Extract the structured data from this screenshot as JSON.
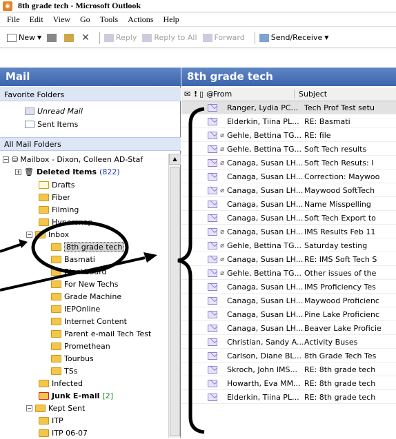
{
  "window": {
    "title": "8th grade tech - Microsoft Outlook"
  },
  "menu": [
    "File",
    "Edit",
    "View",
    "Go",
    "Tools",
    "Actions",
    "Help"
  ],
  "toolbar": {
    "new": "New",
    "reply": "Reply",
    "reply_all": "Reply to All",
    "forward": "Forward",
    "send_receive": "Send/Receive"
  },
  "left": {
    "header": "Mail",
    "favorites_title": "Favorite Folders",
    "favorites": [
      "Unread Mail",
      "Sent Items"
    ],
    "all_title": "All Mail Folders",
    "mailbox": "Mailbox - Dixon, Colleen   AD-Staf",
    "deleted": {
      "label": "Deleted Items",
      "count": "(822)"
    },
    "folders_top": [
      "Drafts",
      "Fiber",
      "Filming",
      "Hypersnap"
    ],
    "inbox": "Inbox",
    "inbox_children": [
      "8th grade tech",
      "Basmati",
      "Blackboard",
      "For New Techs",
      "Grade Machine",
      "IEPOnline",
      "Internet Content",
      "Parent e-mail Tech Test",
      "Promethean",
      "Tourbus",
      "TSs"
    ],
    "infected": "Infected",
    "junk": {
      "label": "Junk E-mail",
      "count": "[2]"
    },
    "kept": "Kept Sent",
    "kept_children": [
      "ITP",
      "ITP 06-07"
    ]
  },
  "right": {
    "header": "8th grade tech",
    "col_from": "From",
    "col_subject": "Subject",
    "messages": [
      {
        "attach": false,
        "from": "Ranger, Lydia   PC...",
        "subject": "Tech Prof Test setu"
      },
      {
        "attach": false,
        "from": "Elderkin, Tiina   PL...",
        "subject": "RE: Basmati"
      },
      {
        "attach": true,
        "from": "Gehle, Bettina   TG...",
        "subject": "RE: file"
      },
      {
        "attach": true,
        "from": "Gehle, Bettina   TG...",
        "subject": "Soft Tech results"
      },
      {
        "attach": true,
        "from": "Canaga, Susan   LH...",
        "subject": "Soft Tech Resuts: I"
      },
      {
        "attach": false,
        "from": "Canaga, Susan   LH...",
        "subject": "Correction: Maywoo"
      },
      {
        "attach": true,
        "from": "Canaga, Susan   LH...",
        "subject": "Maywood SoftTech"
      },
      {
        "attach": false,
        "from": "Canaga, Susan   LH...",
        "subject": "Name Misspelling"
      },
      {
        "attach": false,
        "from": "Canaga, Susan   LH...",
        "subject": "Soft Tech Export to"
      },
      {
        "attach": true,
        "from": "Canaga, Susan   LH...",
        "subject": "IMS Results Feb 11"
      },
      {
        "attach": true,
        "from": "Gehle, Bettina   TG...",
        "subject": "Saturday testing"
      },
      {
        "attach": true,
        "from": "Canaga, Susan   LH...",
        "subject": "RE: IMS Soft Tech S"
      },
      {
        "attach": true,
        "from": "Gehle, Bettina   TG...",
        "subject": "Other issues of the"
      },
      {
        "attach": false,
        "from": "Canaga, Susan   LH...",
        "subject": "IMS Proficiency Tes"
      },
      {
        "attach": false,
        "from": "Canaga, Susan   LH...",
        "subject": "Maywood Proficienc"
      },
      {
        "attach": false,
        "from": "Canaga, Susan   LH...",
        "subject": "Pine Lake Proficienc"
      },
      {
        "attach": false,
        "from": "Canaga, Susan   LH...",
        "subject": "Beaver Lake Proficie"
      },
      {
        "attach": false,
        "from": "Christian, Sandy   A...",
        "subject": "Activity Buses"
      },
      {
        "attach": false,
        "from": "Carlson, Diane   BL...",
        "subject": "8th Grade Tech Tes"
      },
      {
        "attach": false,
        "from": "Skroch, John   IMS...",
        "subject": "RE: 8th grade tech"
      },
      {
        "attach": false,
        "from": "Howarth, Eva   MM...",
        "subject": "RE: 8th grade tech"
      },
      {
        "attach": false,
        "from": "Elderkin, Tiina   PL...",
        "subject": "RE: 8th grade tech"
      }
    ]
  }
}
